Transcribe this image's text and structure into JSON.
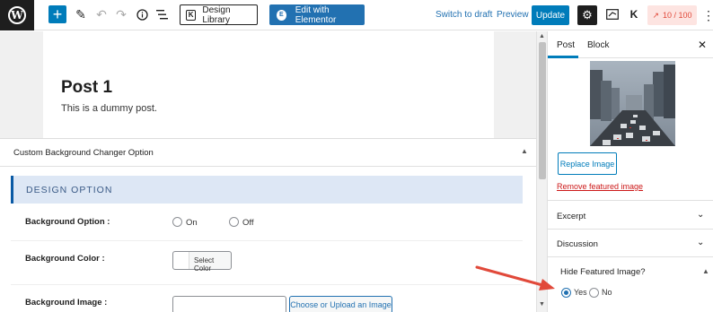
{
  "toolbar": {
    "design_library_label": "Design Library",
    "edit_elementor_label": "Edit with Elementor",
    "switch_to_draft": "Switch to draft",
    "preview": "Preview",
    "update": "Update",
    "score": "10 / 100",
    "icons": [
      "wordpress-logo",
      "plus",
      "pencil",
      "undo",
      "redo",
      "info",
      "list-view",
      "gear",
      "preview-panel",
      "kadence-k",
      "trend-arrow",
      "more-vertical"
    ]
  },
  "post": {
    "title": "Post 1",
    "body": "This is a dummy post."
  },
  "metabox": {
    "title": "Custom Background Changer Option",
    "section_heading": "DESIGN OPTION",
    "background_option_label": "Background Option :",
    "option_on": "On",
    "option_off": "Off",
    "background_color_label": "Background Color :",
    "select_color": "Select Color",
    "background_image_label": "Background Image :",
    "upload_image": "Choose or Upload an Image"
  },
  "sidebar": {
    "tab_post": "Post",
    "tab_block": "Block",
    "replace_image": "Replace Image",
    "remove_image": "Remove featured image",
    "excerpt": "Excerpt",
    "discussion": "Discussion",
    "hide_featured_title": "Hide Featured Image?",
    "yes": "Yes",
    "no": "No",
    "selected": "Yes"
  },
  "colors": {
    "accent": "#007cba",
    "elementor": "#2271b1",
    "danger": "#cc1818",
    "arrow": "#e1493a"
  }
}
